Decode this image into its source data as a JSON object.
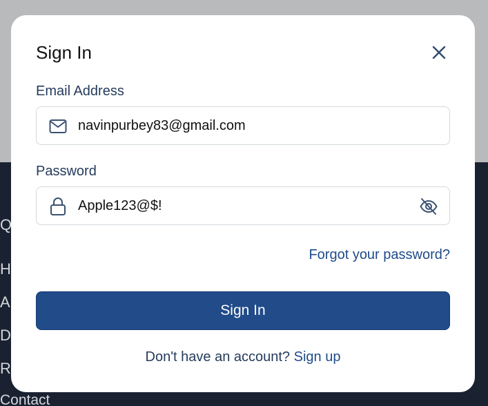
{
  "modal": {
    "title": "Sign In",
    "close_icon": "close-icon"
  },
  "email": {
    "label": "Email Address",
    "value": "navinpurbey83@gmail.com",
    "icon": "mail-icon"
  },
  "password": {
    "label": "Password",
    "value": "Apple123@$!",
    "icon": "lock-icon",
    "toggle_icon": "eye-off-icon"
  },
  "forgot_password_link": "Forgot your password?",
  "signin_button": "Sign In",
  "signup": {
    "prompt": "Don't have an account?",
    "link": "Sign up"
  },
  "background": {
    "footer_letters": [
      "Q",
      "H",
      "A",
      "D",
      "R"
    ],
    "footer_contact": "Contact"
  },
  "colors": {
    "primary": "#214b89",
    "link": "#1e4a8a",
    "overlay": "#b9babc",
    "footer": "#1a2130"
  }
}
